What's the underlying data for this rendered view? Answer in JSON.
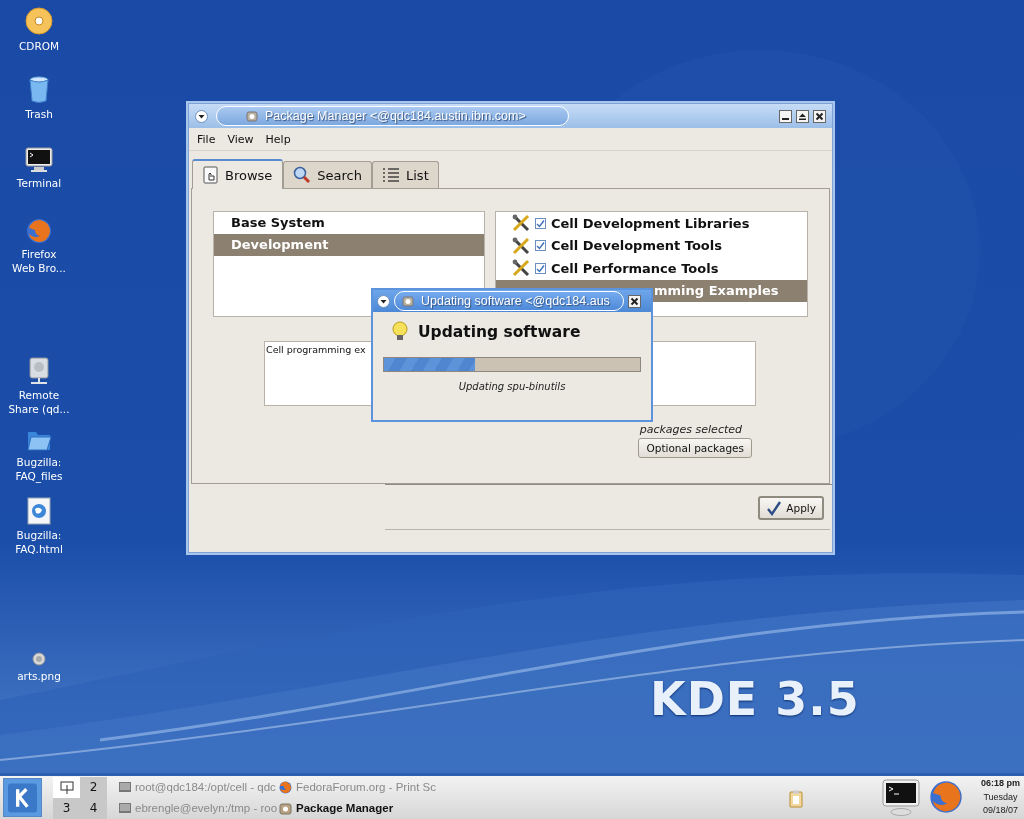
{
  "desktop_icons": [
    {
      "kind": "cdrom",
      "label": "CDROM"
    },
    {
      "kind": "trash",
      "label": "Trash"
    },
    {
      "kind": "terminal",
      "label": "Terminal"
    },
    {
      "kind": "firefox",
      "label": "Firefox\nWeb Bro..."
    },
    {
      "kind": "drive",
      "label": "Remote\nShare (qd..."
    },
    {
      "kind": "folder",
      "label": "Bugzilla:\nFAQ_files"
    },
    {
      "kind": "html",
      "label": "Bugzilla:\nFAQ.html"
    },
    {
      "kind": "image",
      "label": "arts.png"
    }
  ],
  "logo_text": "KDE 3.5",
  "window": {
    "title": "Package Manager <@qdc184.austin.ibm.com>",
    "menu": [
      "File",
      "View",
      "Help"
    ],
    "tabs": [
      {
        "label": "Browse",
        "kind": "browse",
        "selected": true
      },
      {
        "label": "Search",
        "kind": "search",
        "selected": false
      },
      {
        "label": "List",
        "kind": "list",
        "selected": false
      }
    ],
    "groups": [
      {
        "label": "Base System",
        "selected": false
      },
      {
        "label": "Development",
        "selected": true
      }
    ],
    "packages": [
      {
        "label": "Cell Development Libraries",
        "checked": true,
        "selected": false,
        "covered": false
      },
      {
        "label": "Cell Development Tools",
        "checked": true,
        "selected": false,
        "covered": false
      },
      {
        "label": "Cell Performance Tools",
        "checked": true,
        "selected": false,
        "covered": false
      },
      {
        "label": "mming Examples",
        "selected": true,
        "covered": true
      }
    ],
    "description": "Cell programming ex",
    "selected_count": "packages selected",
    "optional_button": "Optional packages",
    "apply_button": "Apply"
  },
  "dialog": {
    "title": "Updating software <@qdc184.aus",
    "heading": "Updating software",
    "progress": {
      "level": 0.355
    },
    "status": "Updating spu-binutils"
  },
  "taskbar": {
    "desktops": [
      {
        "label": "2",
        "selected": false
      },
      {
        "label": "3",
        "selected": false
      },
      {
        "label": "4",
        "selected": false
      }
    ],
    "tasks": [
      {
        "label": "root@qdc184:/opt/cell - qdc",
        "kind": "terminal",
        "active": false
      },
      {
        "label": "FedoraForum.org - Print Sc",
        "kind": "browser",
        "active": false
      },
      {
        "label": "ebrengle@evelyn:/tmp - roo",
        "kind": "terminal",
        "active": false
      },
      {
        "label": "Package Manager",
        "kind": "package",
        "active": true
      }
    ],
    "clock": {
      "time": "06:18 pm",
      "day": "Tuesday",
      "date": "09/18/07"
    }
  }
}
